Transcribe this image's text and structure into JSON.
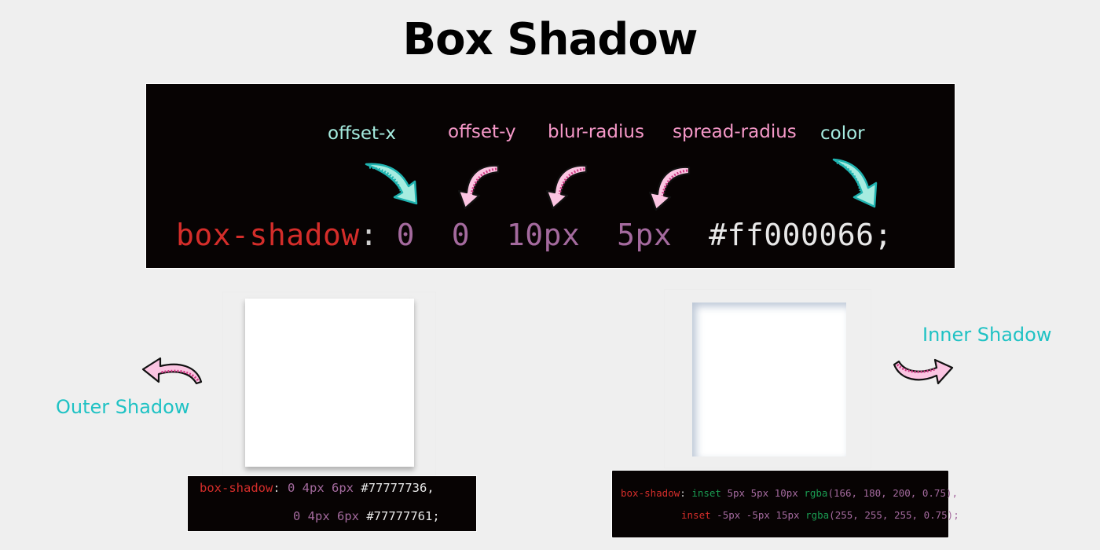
{
  "title": "Box Shadow",
  "main_panel": {
    "labels": {
      "offset_x": "offset-x",
      "offset_y": "offset-y",
      "blur_radius": "blur-radius",
      "spread_radius": "spread-radius",
      "color": "color"
    },
    "code": {
      "property": "box-shadow",
      "colon": ":",
      "offset_x": "0",
      "offset_y": "0",
      "blur": "10px",
      "spread": "5px",
      "color": "#ff000066;"
    }
  },
  "outer_demo": {
    "label": "Outer Shadow",
    "code": {
      "property": "box-shadow",
      "colon": ":",
      "line1_values": "0 4px 6px",
      "line1_color": "#77777736,",
      "line2_values": "0 4px 6px",
      "line2_color": "#77777761;"
    }
  },
  "inner_demo": {
    "label": "Inner Shadow",
    "code": {
      "property": "box-shadow",
      "colon": ":",
      "line1_inset": "inset",
      "line1_values": "5px 5px 10px",
      "line1_fn": "rgba",
      "line1_args": "(166, 180, 200, 0.75),",
      "line2_inset": "inset",
      "line2_values": "-5px -5px 15px",
      "line2_fn": "rgba",
      "line2_args": "(255, 255, 255, 0.75);"
    }
  },
  "colors": {
    "background": "#efefef",
    "code_background": "#070303",
    "property": "#d42d2a",
    "value": "#a46a9e",
    "keyword": "#1a9c52",
    "teal_label": "#a6ece0",
    "pink_label": "#f598c8",
    "side_label": "#1fc2c4"
  }
}
